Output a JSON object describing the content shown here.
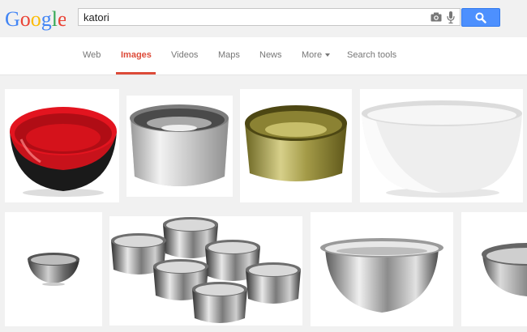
{
  "logo": {
    "letters": [
      "G",
      "o",
      "o",
      "g",
      "l",
      "e"
    ],
    "colors": [
      "#4285f4",
      "#ea4335",
      "#fbbc05",
      "#4285f4",
      "#34a853",
      "#ea4335"
    ]
  },
  "search": {
    "query": "katori",
    "button_icon": "magnifier-icon",
    "camera_icon": "camera-icon",
    "mic_icon": "microphone-icon"
  },
  "tabs": [
    {
      "label": "Web"
    },
    {
      "label": "Images",
      "active": true
    },
    {
      "label": "Videos"
    },
    {
      "label": "Maps"
    },
    {
      "label": "News"
    },
    {
      "label": "More"
    },
    {
      "label": "Search tools"
    }
  ],
  "colors": {
    "accent": "#dd4b39",
    "search_button": "#4d90fe",
    "background": "#f1f1f1"
  },
  "results": [
    {
      "subject": "red and black bowl"
    },
    {
      "subject": "steel katori with hammered rim"
    },
    {
      "subject": "brass katori"
    },
    {
      "subject": "white square bowl"
    },
    {
      "subject": "small steel bowl"
    },
    {
      "subject": "set of six steel katoris"
    },
    {
      "subject": "steel mixing bowl"
    },
    {
      "subject": "steel bowl partial"
    }
  ]
}
